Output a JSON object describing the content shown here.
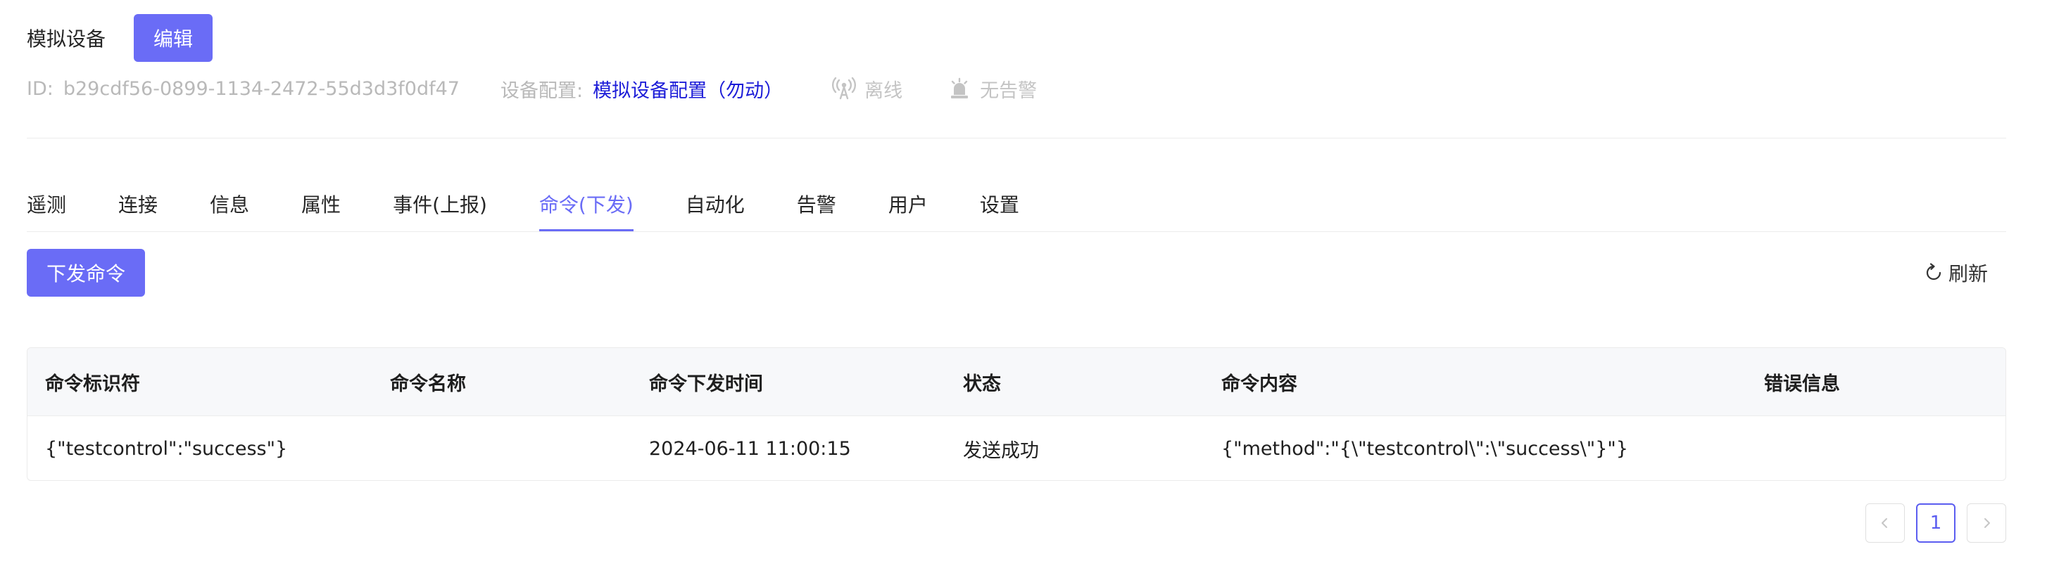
{
  "header": {
    "device_name": "模拟设备",
    "edit_label": "编辑",
    "id_label": "ID:",
    "id_value": "b29cdf56-0899-1134-2472-55d3d3f0df47",
    "config_label": "设备配置:",
    "config_value": "模拟设备配置（勿动）",
    "online_status": "离线",
    "alarm_status": "无告警",
    "online_icon": "signal-tower-icon",
    "alarm_icon": "alarm-bell-icon"
  },
  "tabs": [
    {
      "label": "遥测"
    },
    {
      "label": "连接"
    },
    {
      "label": "信息"
    },
    {
      "label": "属性"
    },
    {
      "label": "事件(上报)"
    },
    {
      "label": "命令(下发)",
      "active": true
    },
    {
      "label": "自动化"
    },
    {
      "label": "告警"
    },
    {
      "label": "用户"
    },
    {
      "label": "设置"
    }
  ],
  "toolbar": {
    "send_label": "下发命令",
    "refresh_label": "刷新",
    "refresh_icon": "refresh-icon"
  },
  "table": {
    "columns": [
      "命令标识符",
      "命令名称",
      "命令下发时间",
      "状态",
      "命令内容",
      "错误信息"
    ],
    "rows": [
      [
        "{\"testcontrol\":\"success\"}",
        "",
        "2024-06-11 11:00:15",
        "发送成功",
        "{\"method\":\"{\\\"testcontrol\\\":\\\"success\\\"}\"}",
        ""
      ]
    ]
  },
  "pagination": {
    "current_page": "1"
  },
  "colors": {
    "accent": "#6a6cf6",
    "link": "#1d1dd8",
    "muted": "#b9b9b9"
  }
}
